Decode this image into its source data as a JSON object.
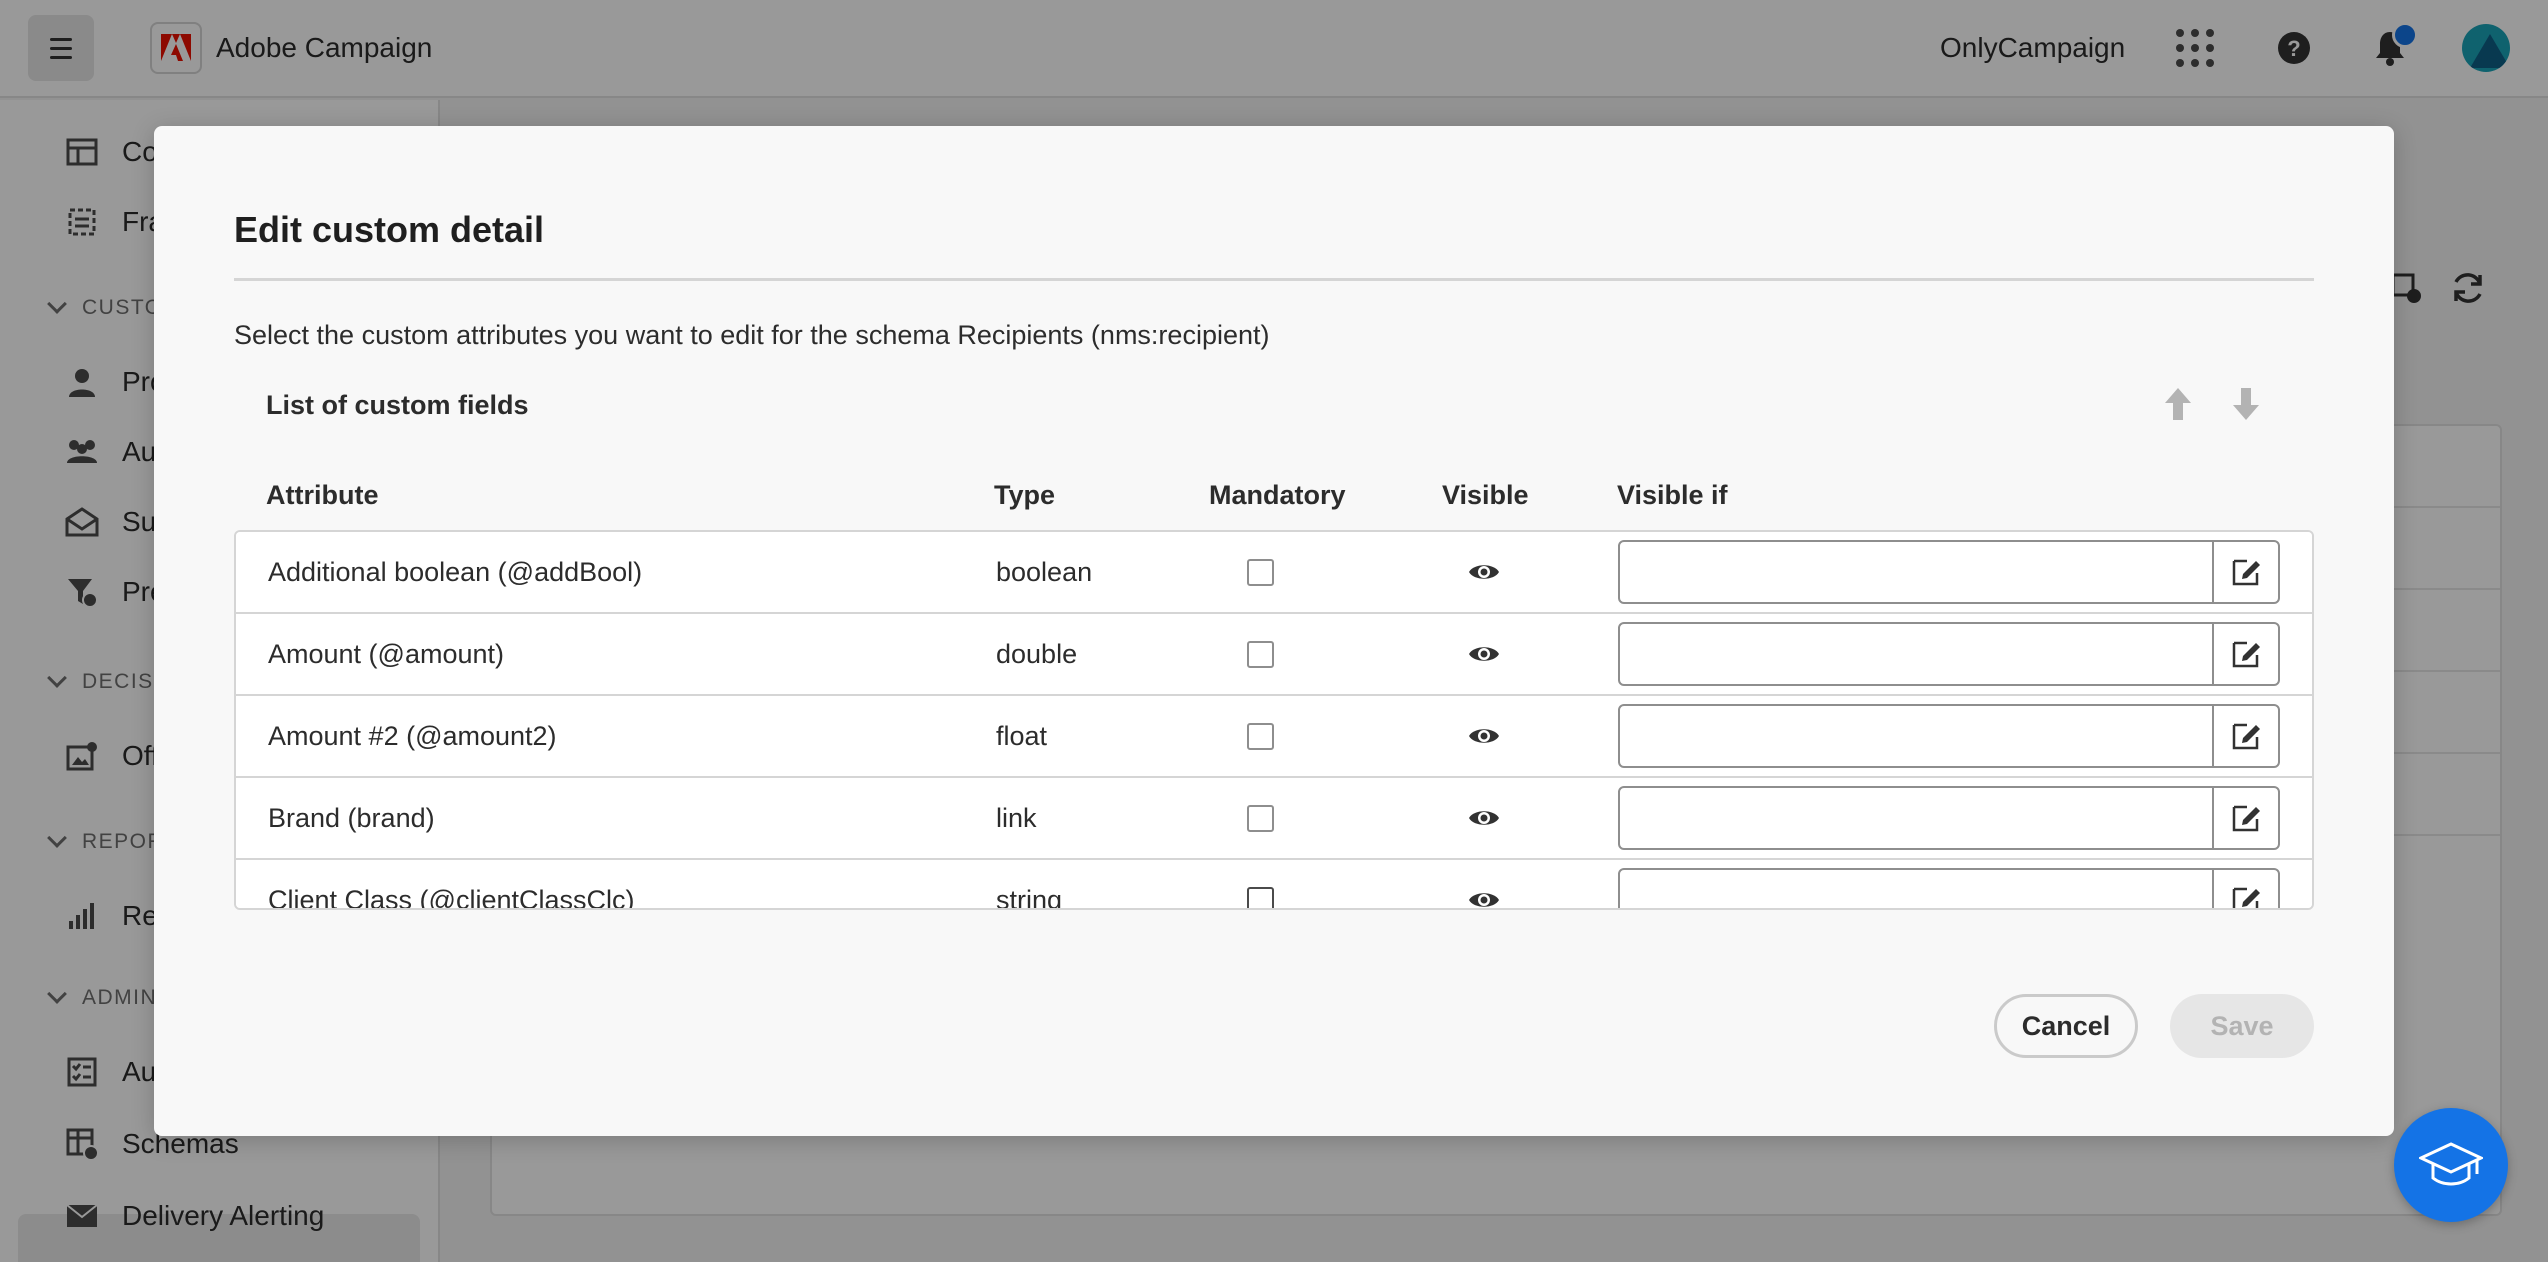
{
  "header": {
    "app_name": "Adobe Campaign",
    "org_name": "OnlyCampaign",
    "icons": [
      "menu-icon",
      "adobe-logo-icon",
      "apps-grid-icon",
      "help-icon",
      "bell-icon",
      "avatar"
    ]
  },
  "sidebar": {
    "items": [
      {
        "label": "Con",
        "icon": "table-icon"
      },
      {
        "label": "Fra",
        "icon": "fragment-icon"
      },
      {
        "section": "CUSTO"
      },
      {
        "label": "Pro",
        "icon": "profile-icon"
      },
      {
        "label": "Au",
        "icon": "audience-icon"
      },
      {
        "label": "Sub",
        "icon": "subscription-icon"
      },
      {
        "label": "Pre",
        "icon": "filter-icon"
      },
      {
        "section": "DECIS"
      },
      {
        "label": "Off",
        "icon": "offer-icon"
      },
      {
        "section": "REPOR"
      },
      {
        "label": "Rep",
        "icon": "report-icon"
      },
      {
        "section": "ADMIN"
      },
      {
        "label": "Au",
        "icon": "audit-icon"
      },
      {
        "label": "Schemas",
        "icon": "schema-icon",
        "active": true
      },
      {
        "label": "Delivery Alerting",
        "icon": "mail-alert-icon"
      }
    ]
  },
  "dialog": {
    "title": "Edit custom detail",
    "description": "Select the custom attributes you want to edit for the schema Recipients (nms:recipient)",
    "list_title": "List of custom fields",
    "columns": {
      "attribute": "Attribute",
      "type": "Type",
      "mandatory": "Mandatory",
      "visible": "Visible",
      "visible_if": "Visible if"
    },
    "rows": [
      {
        "attribute": "Additional boolean (@addBool)",
        "type": "boolean",
        "mandatory": false,
        "visible": true,
        "visible_if": ""
      },
      {
        "attribute": "Amount (@amount)",
        "type": "double",
        "mandatory": false,
        "visible": true,
        "visible_if": ""
      },
      {
        "attribute": "Amount #2 (@amount2)",
        "type": "float",
        "mandatory": false,
        "visible": true,
        "visible_if": ""
      },
      {
        "attribute": "Brand (brand)",
        "type": "link",
        "mandatory": false,
        "visible": true,
        "visible_if": ""
      },
      {
        "attribute": "Client Class (@clientClassClc)",
        "type": "string",
        "mandatory": false,
        "visible": true,
        "visible_if": ""
      }
    ],
    "cancel_label": "Cancel",
    "save_label": "Save"
  },
  "colors": {
    "accent": "#1473e6",
    "adobe_red": "#eb1000",
    "overlay": "rgba(0,0,0,0.4)"
  }
}
